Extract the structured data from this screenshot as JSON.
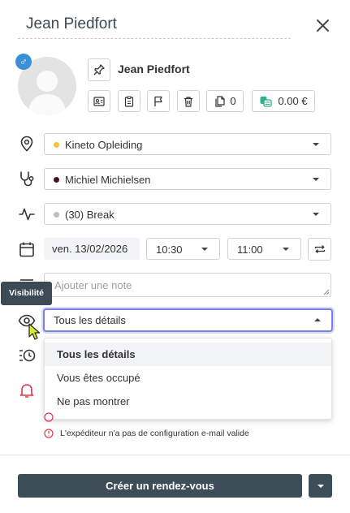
{
  "header": {
    "title": "Jean Piedfort"
  },
  "patient": {
    "name": "Jean Piedfort",
    "gender_symbol": "♂"
  },
  "toolbar": {
    "documents_count": "0",
    "balance": "0.00 €"
  },
  "location": {
    "value": "Kineto Opleiding",
    "dot_color": "#f5c33b"
  },
  "therapist": {
    "value": "Michiel Michielsen",
    "dot_color": "#4a1220"
  },
  "service": {
    "value": "(30) Break",
    "dot_color": "#bdbdbd"
  },
  "schedule": {
    "date": "ven. 13/02/2026",
    "start": "10:30",
    "end": "11:00"
  },
  "note": {
    "placeholder": "Ajouter une note"
  },
  "visibility": {
    "tooltip": "Visibilité",
    "selected": "Tous les détails",
    "options": [
      "Tous les détails",
      "Vous êtes occupé",
      "Ne pas montrer"
    ]
  },
  "warnings": {
    "email": "L'expéditeur n'a pas de configuration e-mail valide"
  },
  "footer": {
    "create_label": "Créer un rendez-vous"
  },
  "colors": {
    "accent": "#7b7fe8",
    "button_dark": "#3e4e59",
    "warning": "#e0344b",
    "money_green": "#2bb38a"
  }
}
